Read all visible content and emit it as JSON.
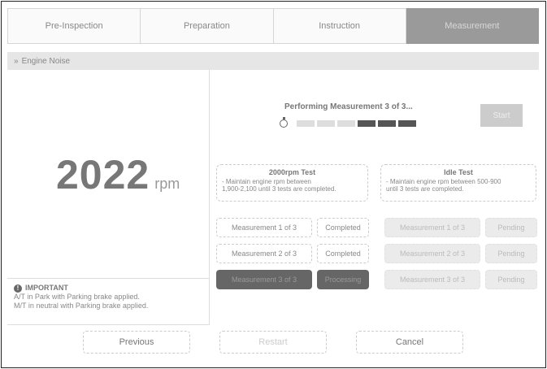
{
  "tabs": [
    {
      "label": "Pre-Inspection",
      "active": false
    },
    {
      "label": "Preparation",
      "active": false
    },
    {
      "label": "Instruction",
      "active": false
    },
    {
      "label": "Measurement",
      "active": true
    }
  ],
  "noise_bar": {
    "icon": "chevron-right-icon",
    "label": "Engine Noise"
  },
  "rpm": {
    "value": "2022",
    "unit": "rpm"
  },
  "important": {
    "title": "IMPORTANT",
    "line1": "A/T in Park with Parking brake applied.",
    "line2": "M/T in neutral with Parking brake applied."
  },
  "measurement": {
    "status": "Performing Measurement 3 of 3...",
    "progress_filled": 3,
    "progress_total": 6,
    "start_label": "Start"
  },
  "test_a": {
    "title": "2000rpm Test",
    "desc_line1": "- Maintain engine rpm between",
    "desc_line2": "1,900-2,100 until 3 tests are completed.",
    "rows": [
      {
        "label": "Measurement 1 of 3",
        "status": "Completed",
        "state": "done"
      },
      {
        "label": "Measurement 2 of 3",
        "status": "Completed",
        "state": "done"
      },
      {
        "label": "Measurement 3 of 3",
        "status": "Processing",
        "state": "active"
      }
    ]
  },
  "test_b": {
    "title": "Idle Test",
    "desc_line1": "- Maintain engine rpm between 500-900",
    "desc_line2": "until 3 tests are completed.",
    "rows": [
      {
        "label": "Measurement 1 of 3",
        "status": "Pending",
        "state": "pending"
      },
      {
        "label": "Measurement 2 of 3",
        "status": "Pending",
        "state": "pending"
      },
      {
        "label": "Measurement 3 of 3",
        "status": "Pending",
        "state": "pending"
      }
    ]
  },
  "bottom": {
    "previous": "Previous",
    "restart": "Restart",
    "cancel": "Cancel"
  }
}
